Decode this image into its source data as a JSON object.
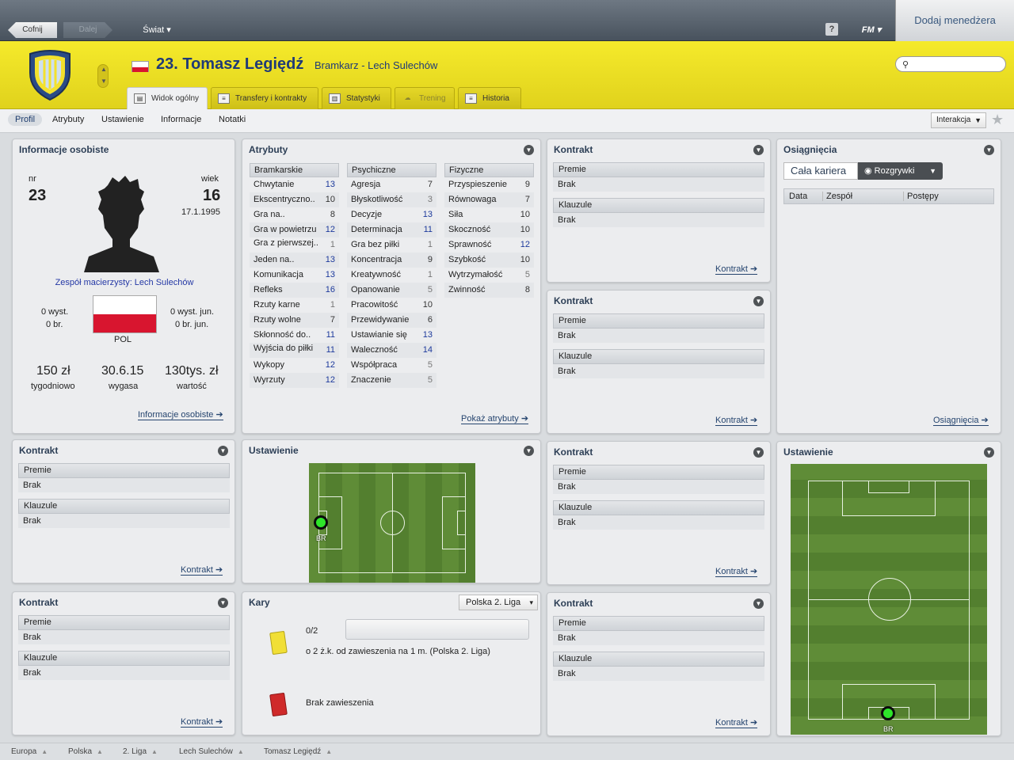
{
  "topbar": {
    "back": "Cofnij",
    "forward": "Dalej",
    "world": "Świat",
    "help": "?",
    "fm": "FM",
    "add_manager": "Dodaj menedżera"
  },
  "header": {
    "name": "23. Tomasz Legiędź",
    "role": "Bramkarz - Lech Sulechów",
    "search_placeholder": ""
  },
  "tabs": [
    "Widok ogólny",
    "Transfery i kontrakty",
    "Statystyki",
    "Trening",
    "Historia"
  ],
  "subnav": {
    "items": [
      "Profil",
      "Atrybuty",
      "Ustawienie",
      "Informacje",
      "Notatki"
    ],
    "interaction": "Interakcja"
  },
  "personal": {
    "title": "Informacje osobiste",
    "nr_label": "nr",
    "nr": "23",
    "age_label": "wiek",
    "age": "16",
    "dob": "17.1.1995",
    "home_team": "Zespół macierzysty: Lech Sulechów",
    "caps": "0 wyst.",
    "goals": "0 br.",
    "youth_caps": "0 wyst. jun.",
    "youth_goals": "0 br. jun.",
    "nation": "POL",
    "wage": "150 zł",
    "wage_label": "tygodniowo",
    "expires": "30.6.15",
    "expires_label": "wygasa",
    "value": "130tys. zł",
    "value_label": "wartość",
    "link": "Informacje osobiste"
  },
  "attributes": {
    "title": "Atrybuty",
    "link": "Pokaż atrybuty",
    "columns": [
      {
        "name": "Bramkarskie",
        "rows": [
          {
            "n": "Chwytanie",
            "v": "13"
          },
          {
            "n": "Ekscentryczno..",
            "v": "10"
          },
          {
            "n": "Gra na..",
            "v": "8"
          },
          {
            "n": "Gra w powietrzu",
            "v": "12"
          },
          {
            "n": "Gra z pierwszej..",
            "v": "1"
          },
          {
            "n": "Jeden na..",
            "v": "13"
          },
          {
            "n": "Komunikacja",
            "v": "13"
          },
          {
            "n": "Refleks",
            "v": "16"
          },
          {
            "n": "Rzuty karne",
            "v": "1"
          },
          {
            "n": "Rzuty wolne",
            "v": "7"
          },
          {
            "n": "Skłonność do..",
            "v": "11"
          },
          {
            "n": "Wyjścia do piłki",
            "v": "11"
          },
          {
            "n": "Wykopy",
            "v": "12"
          },
          {
            "n": "Wyrzuty",
            "v": "12"
          }
        ]
      },
      {
        "name": "Psychiczne",
        "rows": [
          {
            "n": "Agresja",
            "v": "7"
          },
          {
            "n": "Błyskotliwość",
            "v": "3"
          },
          {
            "n": "Decyzje",
            "v": "13"
          },
          {
            "n": "Determinacja",
            "v": "11"
          },
          {
            "n": "Gra bez piłki",
            "v": "1"
          },
          {
            "n": "Koncentracja",
            "v": "9"
          },
          {
            "n": "Kreatywność",
            "v": "1"
          },
          {
            "n": "Opanowanie",
            "v": "5"
          },
          {
            "n": "Pracowitość",
            "v": "10"
          },
          {
            "n": "Przewidywanie",
            "v": "6"
          },
          {
            "n": "Ustawianie się",
            "v": "13"
          },
          {
            "n": "Waleczność",
            "v": "14"
          },
          {
            "n": "Współpraca",
            "v": "5"
          },
          {
            "n": "Znaczenie",
            "v": "5"
          }
        ]
      },
      {
        "name": "Fizyczne",
        "rows": [
          {
            "n": "Przyspieszenie",
            "v": "9"
          },
          {
            "n": "Równowaga",
            "v": "7"
          },
          {
            "n": "Siła",
            "v": "10"
          },
          {
            "n": "Skoczność",
            "v": "10"
          },
          {
            "n": "Sprawność",
            "v": "12"
          },
          {
            "n": "Szybkość",
            "v": "10"
          },
          {
            "n": "Wytrzymałość",
            "v": "5"
          },
          {
            "n": "Zwinność",
            "v": "8"
          }
        ]
      }
    ]
  },
  "contract": {
    "title": "Kontrakt",
    "bonus": "Premie",
    "bonus_val": "Brak",
    "clauses": "Klauzule",
    "clauses_val": "Brak",
    "link": "Kontrakt"
  },
  "achievements": {
    "title": "Osiągnięcia",
    "tab_career": "Cała kariera",
    "tab_comp": "Rozgrywki",
    "cols": [
      "Data",
      "Zespół",
      "Postępy"
    ],
    "link": "Osiągnięcia"
  },
  "formation": {
    "title": "Ustawienie",
    "pos": "BR"
  },
  "penalties": {
    "title": "Kary",
    "league_select": "Polska 2. Liga",
    "count": "0/2",
    "yellow_text": "o 2 ż.k. od zawieszenia na 1 m. (Polska 2. Liga)",
    "red_text": "Brak zawieszenia",
    "progress": 0
  },
  "footer": [
    "Europa",
    "Polska",
    "2. Liga",
    "Lech Sulechów",
    "Tomasz Legiędź"
  ],
  "colors": {
    "header_yellow": "#f2e52a",
    "accent_blue": "#1f3a78",
    "player_dot": "#2ee52a"
  }
}
